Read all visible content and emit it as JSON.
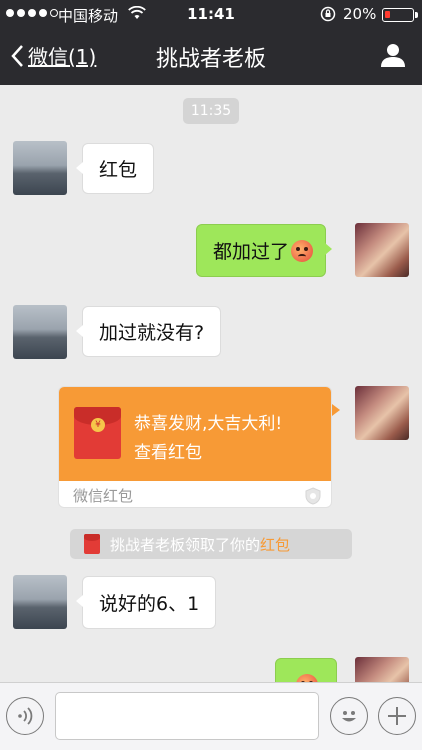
{
  "status_bar": {
    "carrier": "中国移动",
    "time": "11:41",
    "battery_percent": "20%",
    "battery_level": 0.2,
    "signal_bars": 4
  },
  "nav": {
    "back_label": "微信(1)",
    "title": "挑战者老板"
  },
  "chat": {
    "timestamp": "11:35",
    "messages": [
      {
        "side": "in",
        "text": "红包"
      },
      {
        "side": "out",
        "text": "都加过了"
      },
      {
        "side": "in",
        "text": "加过就没有?"
      },
      {
        "side": "out",
        "type": "red_packet",
        "title": "恭喜发财,大吉大利!",
        "subtitle": "查看红包",
        "footer": "微信红包"
      },
      {
        "side": "in",
        "text": "说好的6、1"
      },
      {
        "side": "out",
        "type": "emoji_partial"
      }
    ],
    "notice": {
      "text": "挑战者老板领取了你的",
      "link": "红包"
    }
  },
  "input": {
    "value": "",
    "placeholder": ""
  },
  "colors": {
    "nav_bg": "#2b2b2f",
    "chat_bg": "#ebebeb",
    "outgoing_bubble": "#9ee75a",
    "red_packet": "#f79a36",
    "battery_low": "#ff3b30"
  }
}
